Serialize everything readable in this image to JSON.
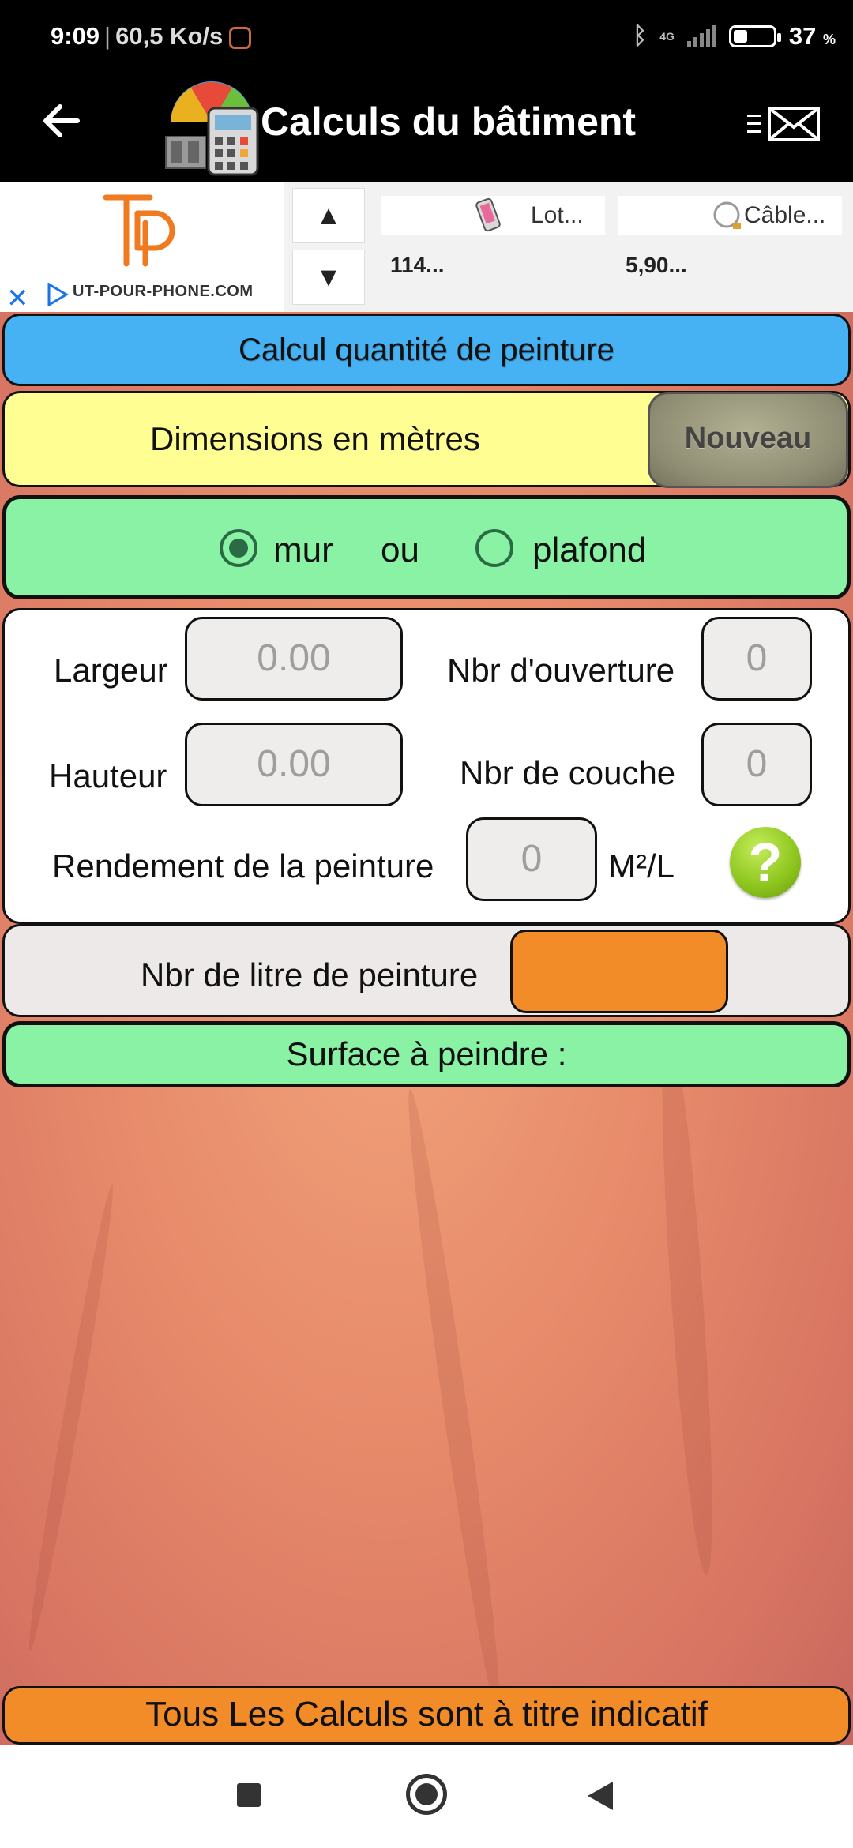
{
  "status_bar": {
    "time": "9:09",
    "network_speed": "60,5 Ko/s",
    "network_type": "4G",
    "battery_percent": "37",
    "battery_unit": "%"
  },
  "app_bar": {
    "title": "Calculs du bâtiment",
    "back_icon": "arrow-left-icon",
    "menu_icon": "menu-mail-icon"
  },
  "ad": {
    "domain": "UT-POUR-PHONE.COM",
    "close_symbol": "✕",
    "up_arrow": "▲",
    "down_arrow": "▼",
    "products": [
      {
        "name": "Lot...",
        "price": "114..."
      },
      {
        "name": "Câble...",
        "price": "5,90..."
      }
    ]
  },
  "calculator": {
    "title": "Calcul quantité de peinture",
    "dimensions_label": "Dimensions en mètres",
    "new_button": "Nouveau",
    "surface_type": {
      "option_wall": "mur",
      "separator": "ou",
      "option_ceiling": "plafond",
      "selected": "mur"
    },
    "fields": {
      "largeur_label": "Largeur",
      "largeur_placeholder": "0.00",
      "hauteur_label": "Hauteur",
      "hauteur_placeholder": "0.00",
      "ouvertures_label": "Nbr d'ouverture",
      "ouvertures_placeholder": "0",
      "couches_label": "Nbr de couche",
      "couches_placeholder": "0",
      "rendement_label": "Rendement de la peinture",
      "rendement_placeholder": "0",
      "rendement_unit": "M²/L"
    },
    "help_symbol": "?",
    "litres_label": "Nbr de litre de peinture",
    "surface_label": "Surface à peindre :"
  },
  "footer": {
    "disclaimer": "Tous Les Calculs sont à titre indicatif"
  },
  "colors": {
    "title_blue": "#47b2f3",
    "dimension_yellow": "#fefe92",
    "green_panel": "#8af2a4",
    "orange": "#f28c28",
    "help_green": "#8cc41c"
  }
}
